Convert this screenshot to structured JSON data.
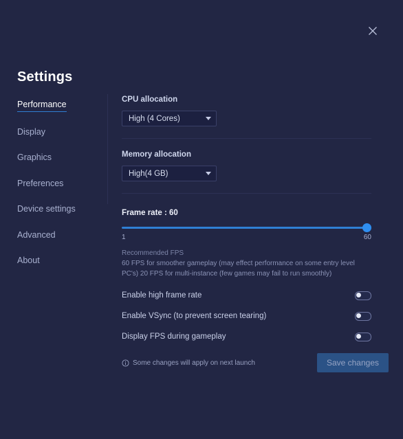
{
  "window": {
    "title": "Settings",
    "close_icon": "close-icon"
  },
  "sidebar": {
    "items": [
      {
        "label": "Performance",
        "active": true
      },
      {
        "label": "Display",
        "active": false
      },
      {
        "label": "Graphics",
        "active": false
      },
      {
        "label": "Preferences",
        "active": false
      },
      {
        "label": "Device settings",
        "active": false
      },
      {
        "label": "Advanced",
        "active": false
      },
      {
        "label": "About",
        "active": false
      }
    ]
  },
  "main": {
    "cpu": {
      "label": "CPU allocation",
      "value": "High (4 Cores)",
      "caret_icon": "chevron-down-icon"
    },
    "memory": {
      "label": "Memory allocation",
      "value": "High(4 GB)",
      "caret_icon": "chevron-down-icon"
    },
    "frame_rate": {
      "label": "Frame rate : 60",
      "value": 60,
      "min_label": "1",
      "max_label": "60",
      "min": 1,
      "max": 60,
      "recommended_title": "Recommended FPS",
      "recommended_text": "60 FPS for smoother gameplay (may effect performance on some entry level PC's) 20 FPS for multi-instance (few games may fail to run smoothly)"
    },
    "toggles": [
      {
        "label": "Enable high frame rate",
        "on": false
      },
      {
        "label": "Enable VSync (to prevent screen tearing)",
        "on": false
      },
      {
        "label": "Display FPS during gameplay",
        "on": false
      }
    ]
  },
  "footer": {
    "info_icon": "info-circle-icon",
    "note": "Some changes will apply on next launch",
    "save_label": "Save changes"
  },
  "colors": {
    "background": "#222644",
    "accent": "#2f7fd4",
    "slider_thumb": "#2f8ef0",
    "save_button": "#2b5286",
    "text_primary": "#ffffff",
    "text_muted": "#8b93b6"
  }
}
